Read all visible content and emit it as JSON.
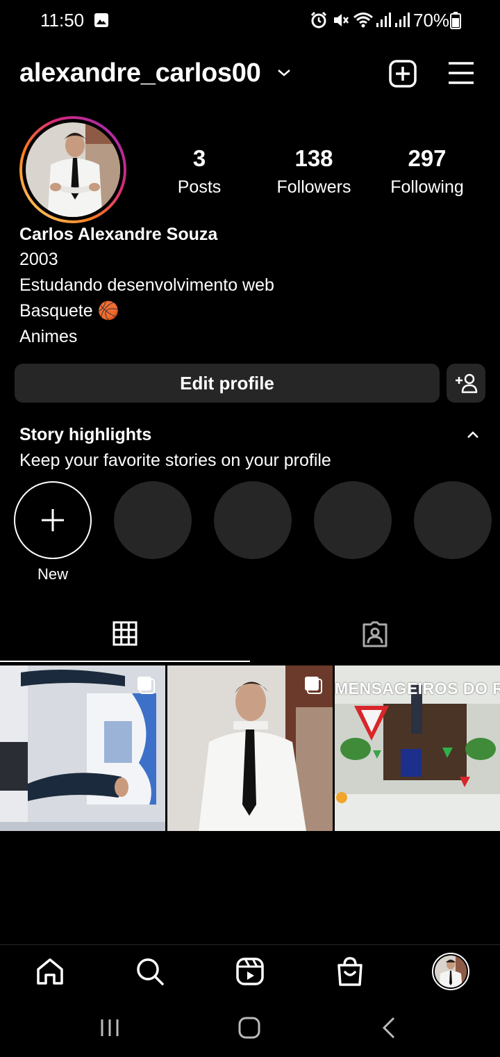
{
  "status_bar": {
    "time": "11:50",
    "battery": "70%"
  },
  "header": {
    "username": "alexandre_carlos00"
  },
  "stats": [
    {
      "value": "3",
      "label": "Posts"
    },
    {
      "value": "138",
      "label": "Followers"
    },
    {
      "value": "297",
      "label": "Following"
    }
  ],
  "bio": {
    "name": "Carlos Alexandre Souza",
    "lines": [
      "2003",
      "Estudando desenvolvimento web",
      "Basquete 🏀",
      "Animes"
    ]
  },
  "actions": {
    "edit_profile": "Edit profile"
  },
  "highlights": {
    "title": "Story highlights",
    "subtitle": "Keep your favorite stories on your profile",
    "new_label": "New"
  },
  "posts_overlay_text": "MENSAGEIROS DO REI",
  "colors": {
    "background": "#000000",
    "surface": "#262626",
    "text": "#ffffff"
  },
  "icons": [
    "gallery-notification-icon",
    "alarm-icon",
    "mute-icon",
    "wifi-icon",
    "signal-icon",
    "battery-icon",
    "chevron-down-icon",
    "create-post-icon",
    "menu-icon",
    "add-person-icon",
    "chevron-up-icon",
    "plus-icon",
    "grid-icon",
    "tagged-icon",
    "multiple-photos-icon",
    "home-icon",
    "search-icon",
    "reels-icon",
    "shop-icon",
    "profile-avatar"
  ]
}
